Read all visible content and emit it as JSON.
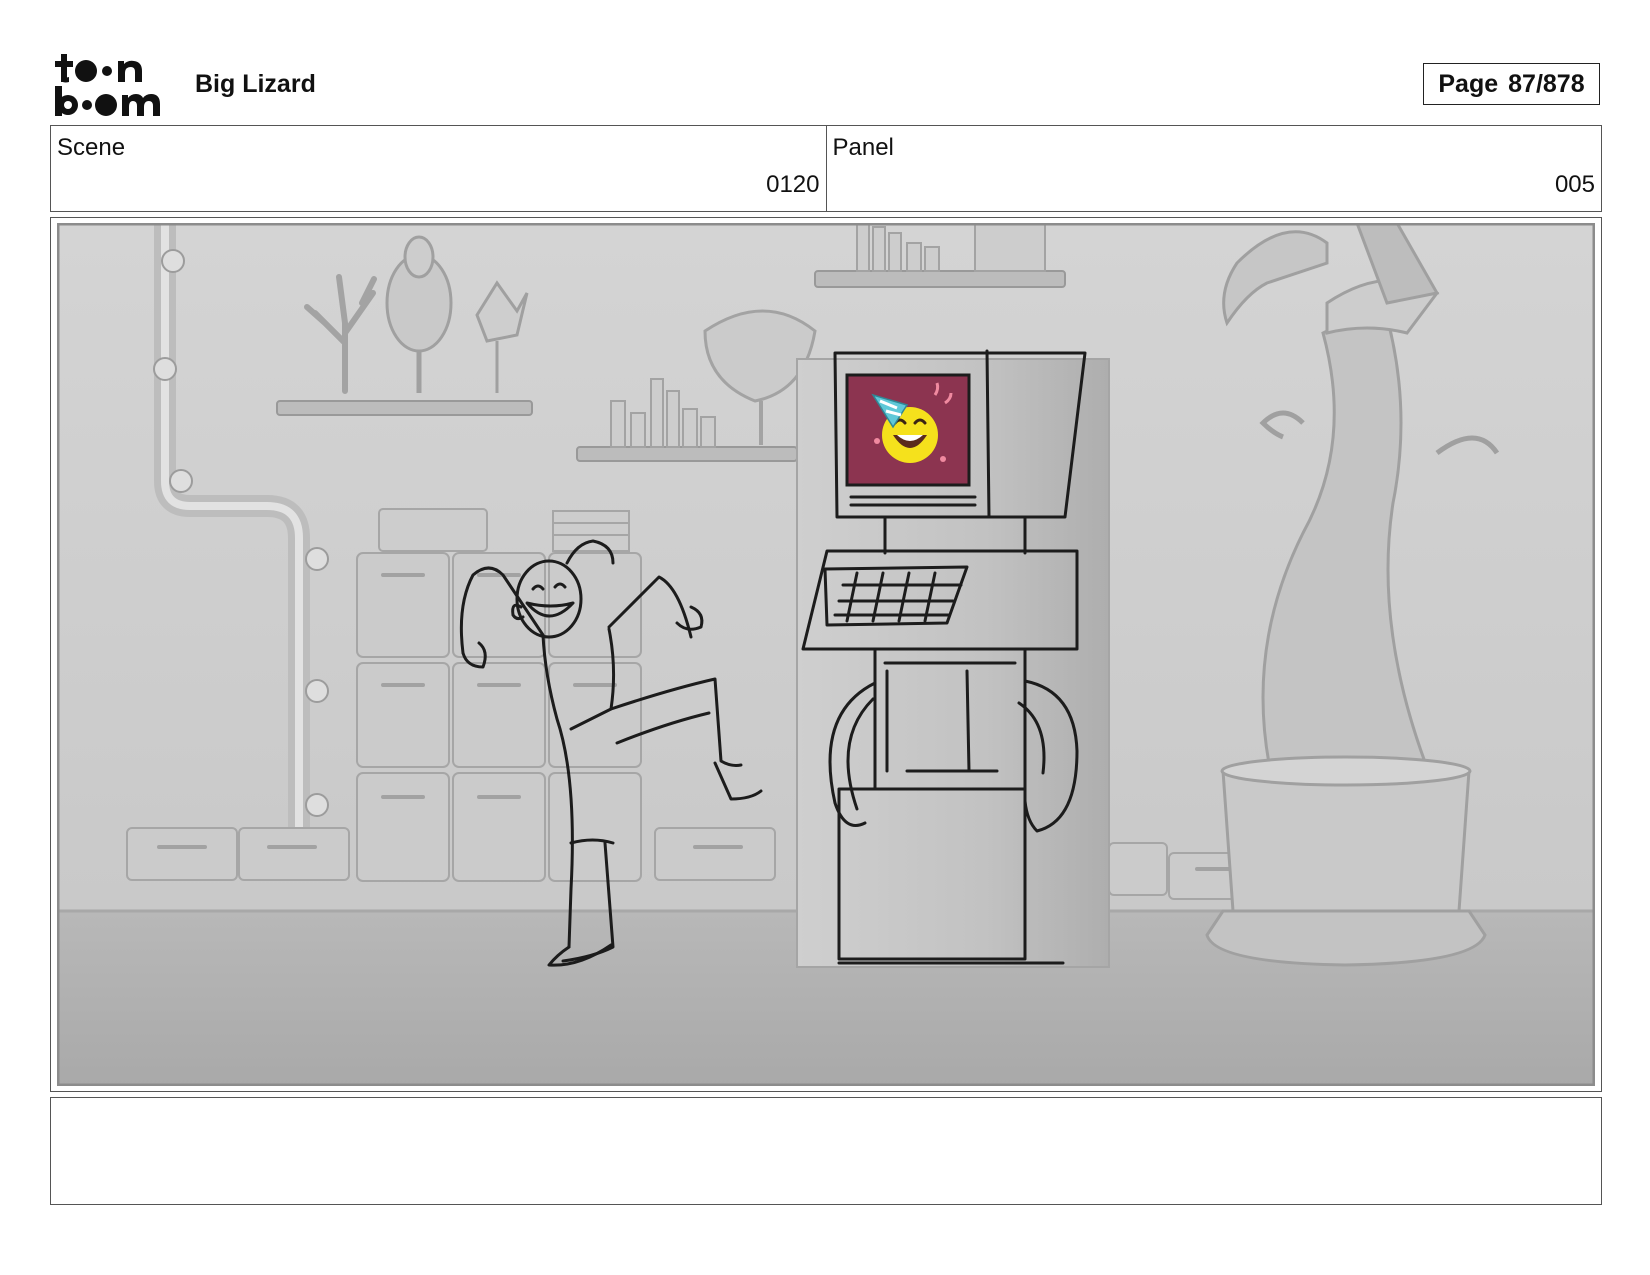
{
  "header": {
    "logo_label": "toon boom",
    "project_title": "Big Lizard",
    "page_label": "Page",
    "page_number": "87/878"
  },
  "info": {
    "scene_label": "Scene",
    "scene_value": "0120",
    "panel_label": "Panel",
    "panel_value": "005"
  },
  "notes": {
    "text": ""
  },
  "colors": {
    "screen_background": "#8c3450",
    "emoji_face": "#f5e11c",
    "party_hat": "#5fc8d8"
  }
}
